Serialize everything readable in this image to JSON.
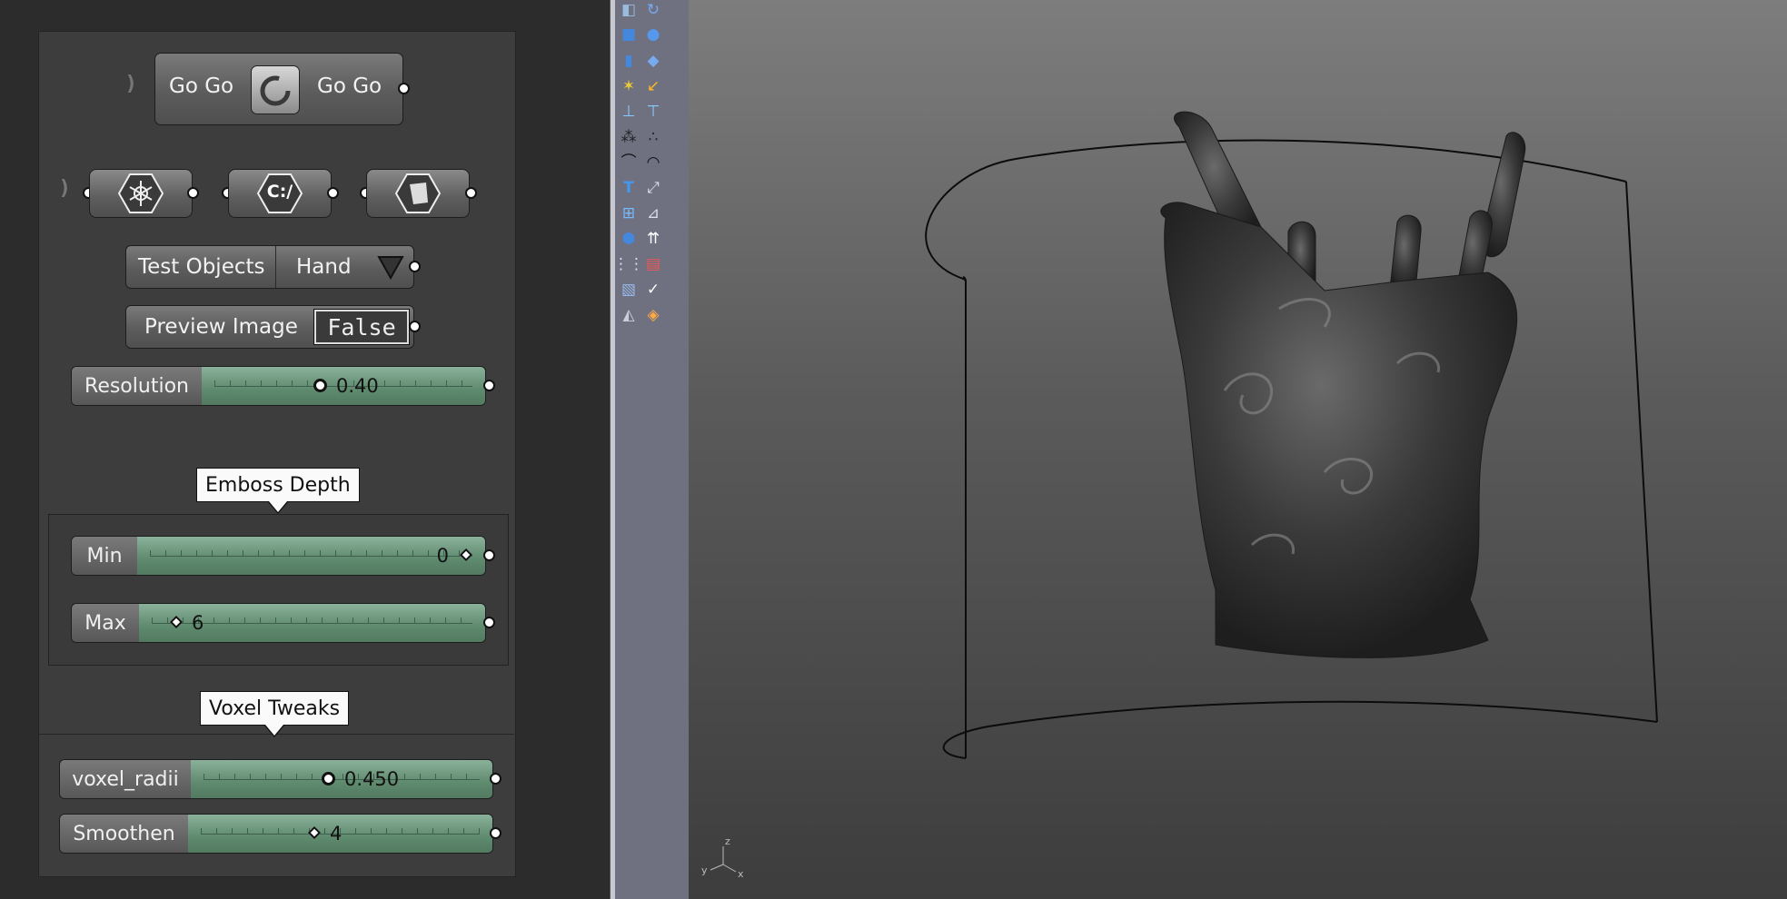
{
  "gogo": {
    "left_label": "Go Go",
    "right_label": "Go Go"
  },
  "icons_row": [
    "snowflake-component",
    "file-path-component",
    "shape-component"
  ],
  "icon_texts": {
    "file_path": "C:/"
  },
  "test_objects": {
    "label": "Test Objects",
    "value": "Hand"
  },
  "preview_image": {
    "label": "Preview Image",
    "value": "False"
  },
  "resolution": {
    "label": "Resolution",
    "value": "0.40",
    "fraction": 0.4
  },
  "emboss_group": {
    "title": "Emboss Depth"
  },
  "min_slider": {
    "label": "Min",
    "value": "0",
    "fraction": 1.0
  },
  "max_slider": {
    "label": "Max",
    "value": "6",
    "fraction": 0.0
  },
  "voxel_group": {
    "title": "Voxel Tweaks"
  },
  "voxel_radii": {
    "label": "voxel_radii",
    "value": "0.450",
    "fraction": 0.45
  },
  "smoothen": {
    "label": "Smoothen",
    "value": "4",
    "fraction": 0.4
  },
  "toolbar_icons": [
    [
      "rotate-view-icon",
      "orbit-icon"
    ],
    [
      "box-icon",
      "sphere-icon"
    ],
    [
      "cylinder-icon",
      "surface-icon"
    ],
    [
      "explode-icon",
      "render-icon"
    ],
    [
      "split-icon",
      "join-icon"
    ],
    [
      "points-icon",
      "control-points-icon"
    ],
    [
      "curve-icon",
      "arc-icon"
    ],
    [
      "text-icon",
      "dimension-icon"
    ],
    [
      "array-icon",
      "analyze-icon"
    ],
    [
      "solid-icon",
      "move-icon"
    ],
    [
      "grid-icon",
      "layer-icon"
    ],
    [
      "paste-icon",
      "check-icon"
    ],
    [
      "shade-icon",
      "material-icon"
    ]
  ],
  "axis_labels": {
    "z": "z",
    "y": "y",
    "x": "x"
  },
  "colors": {
    "slider_green": "#6a9a7c",
    "canvas_bg": "#2c2c2c",
    "toolbar": "#6f7080"
  }
}
